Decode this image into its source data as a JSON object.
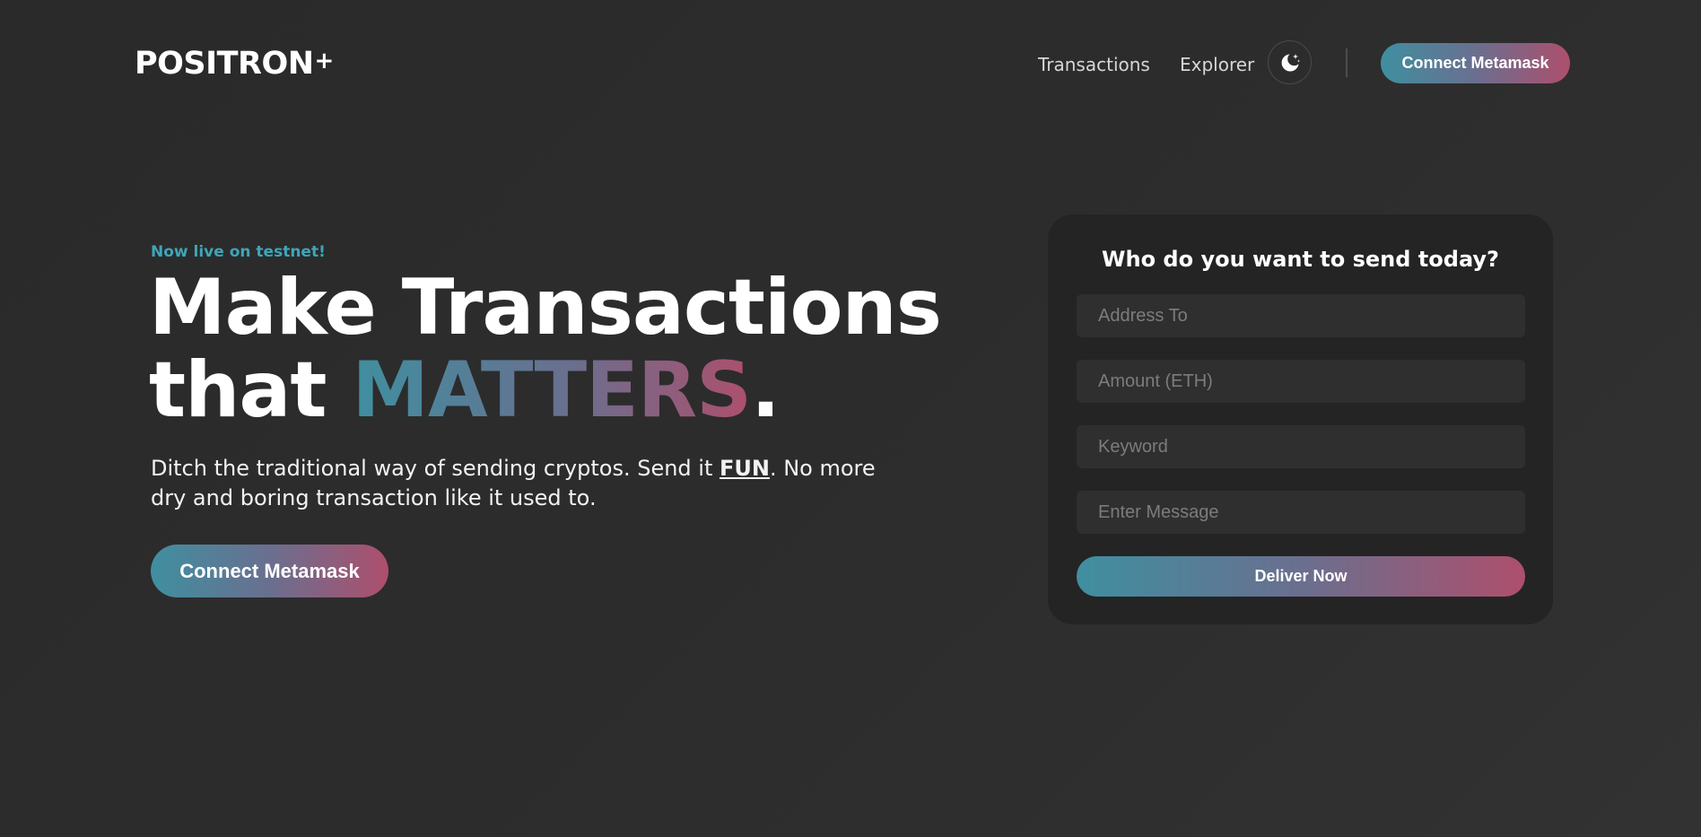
{
  "brand": {
    "name": "POSITRON",
    "mark": "+"
  },
  "nav": {
    "links": [
      "Transactions",
      "Explorer"
    ],
    "theme_icon": "moon-stars-icon",
    "connect_label": "Connect Metamask"
  },
  "hero": {
    "tagline": "Now live on testnet!",
    "headline_line1": "Make Transactions",
    "headline_line2_prefix": "that ",
    "headline_accent": "MATTERS",
    "headline_suffix": ".",
    "subtitle_before": "Ditch the traditional way of sending cryptos. Send it ",
    "subtitle_emphasis": "FUN",
    "subtitle_after": ". No more dry and boring transaction like it used to.",
    "connect_label": "Connect Metamask"
  },
  "form": {
    "title": "Who do you want to send today?",
    "fields": [
      {
        "placeholder": "Address To",
        "value": ""
      },
      {
        "placeholder": "Amount (ETH)",
        "value": ""
      },
      {
        "placeholder": "Keyword",
        "value": ""
      },
      {
        "placeholder": "Enter Message",
        "value": ""
      }
    ],
    "submit_label": "Deliver Now"
  },
  "colors": {
    "accent_start": "#3f8fa0",
    "accent_mid": "#6a6f8f",
    "accent_end": "#ad4f6c",
    "tagline": "#3ea6b8",
    "background": "#2b2b2b",
    "card": "#242424"
  }
}
